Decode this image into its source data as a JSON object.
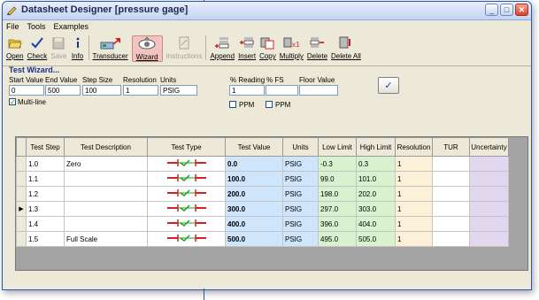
{
  "window": {
    "title": "Datasheet Designer [pressure gage]",
    "minimize": "_",
    "maximize": "□",
    "close": "✕"
  },
  "menu": [
    "File",
    "Tools",
    "Examples"
  ],
  "toolbar": {
    "open": "Open",
    "check": "Check",
    "save": "Save",
    "info": "Info",
    "transducer": "Transducer",
    "wizard": "Wizard",
    "instructions": "Instructions",
    "append": "Append",
    "insert": "Insert",
    "copy": "Copy",
    "multiply": "Multiply",
    "delete": "Delete",
    "delete_all": "Delete All"
  },
  "wizard": {
    "title": "Test Wizard...",
    "labels": {
      "start": "Start Value",
      "end": "End Value",
      "step": "Step Size",
      "resolution": "Resolution",
      "units": "Units",
      "reading": "% Reading",
      "fs": "% FS",
      "floor": "Floor Value"
    },
    "values": {
      "start": "0",
      "end": "500",
      "step": "100",
      "resolution": "1",
      "units": "PSIG",
      "reading": "1",
      "fs": "",
      "floor": ""
    },
    "multiline": "Multi-line",
    "ppm": "PPM",
    "ok_glyph": "✓"
  },
  "grid": {
    "headers": [
      "Test Step",
      "Test Description",
      "Test Type",
      "Test Value",
      "Units",
      "Low Limit",
      "High Limit",
      "Resolution",
      "TUR",
      "Uncertainty"
    ],
    "rows": [
      {
        "step": "1.0",
        "desc": "Zero",
        "value": "0.0",
        "units": "PSIG",
        "low": "-0.3",
        "high": "0.3",
        "res": "1"
      },
      {
        "step": "1.1",
        "desc": "",
        "value": "100.0",
        "units": "PSIG",
        "low": "99.0",
        "high": "101.0",
        "res": "1"
      },
      {
        "step": "1.2",
        "desc": "",
        "value": "200.0",
        "units": "PSIG",
        "low": "198.0",
        "high": "202.0",
        "res": "1"
      },
      {
        "step": "1.3",
        "desc": "",
        "value": "300.0",
        "units": "PSIG",
        "low": "297.0",
        "high": "303.0",
        "res": "1"
      },
      {
        "step": "1.4",
        "desc": "",
        "value": "400.0",
        "units": "PSIG",
        "low": "396.0",
        "high": "404.0",
        "res": "1"
      },
      {
        "step": "1.5",
        "desc": "Full Scale",
        "value": "500.0",
        "units": "PSIG",
        "low": "495.0",
        "high": "505.0",
        "res": "1"
      }
    ],
    "current_marker": "▶"
  },
  "colors": {
    "value_bg": "#cfe5fb",
    "limit_bg": "#d8f2d0",
    "resolution_bg": "#fcf0d8",
    "uncertainty_bg": "#e1d8ef",
    "test_type_red": "#d62020",
    "test_type_green": "#1fa01f"
  }
}
